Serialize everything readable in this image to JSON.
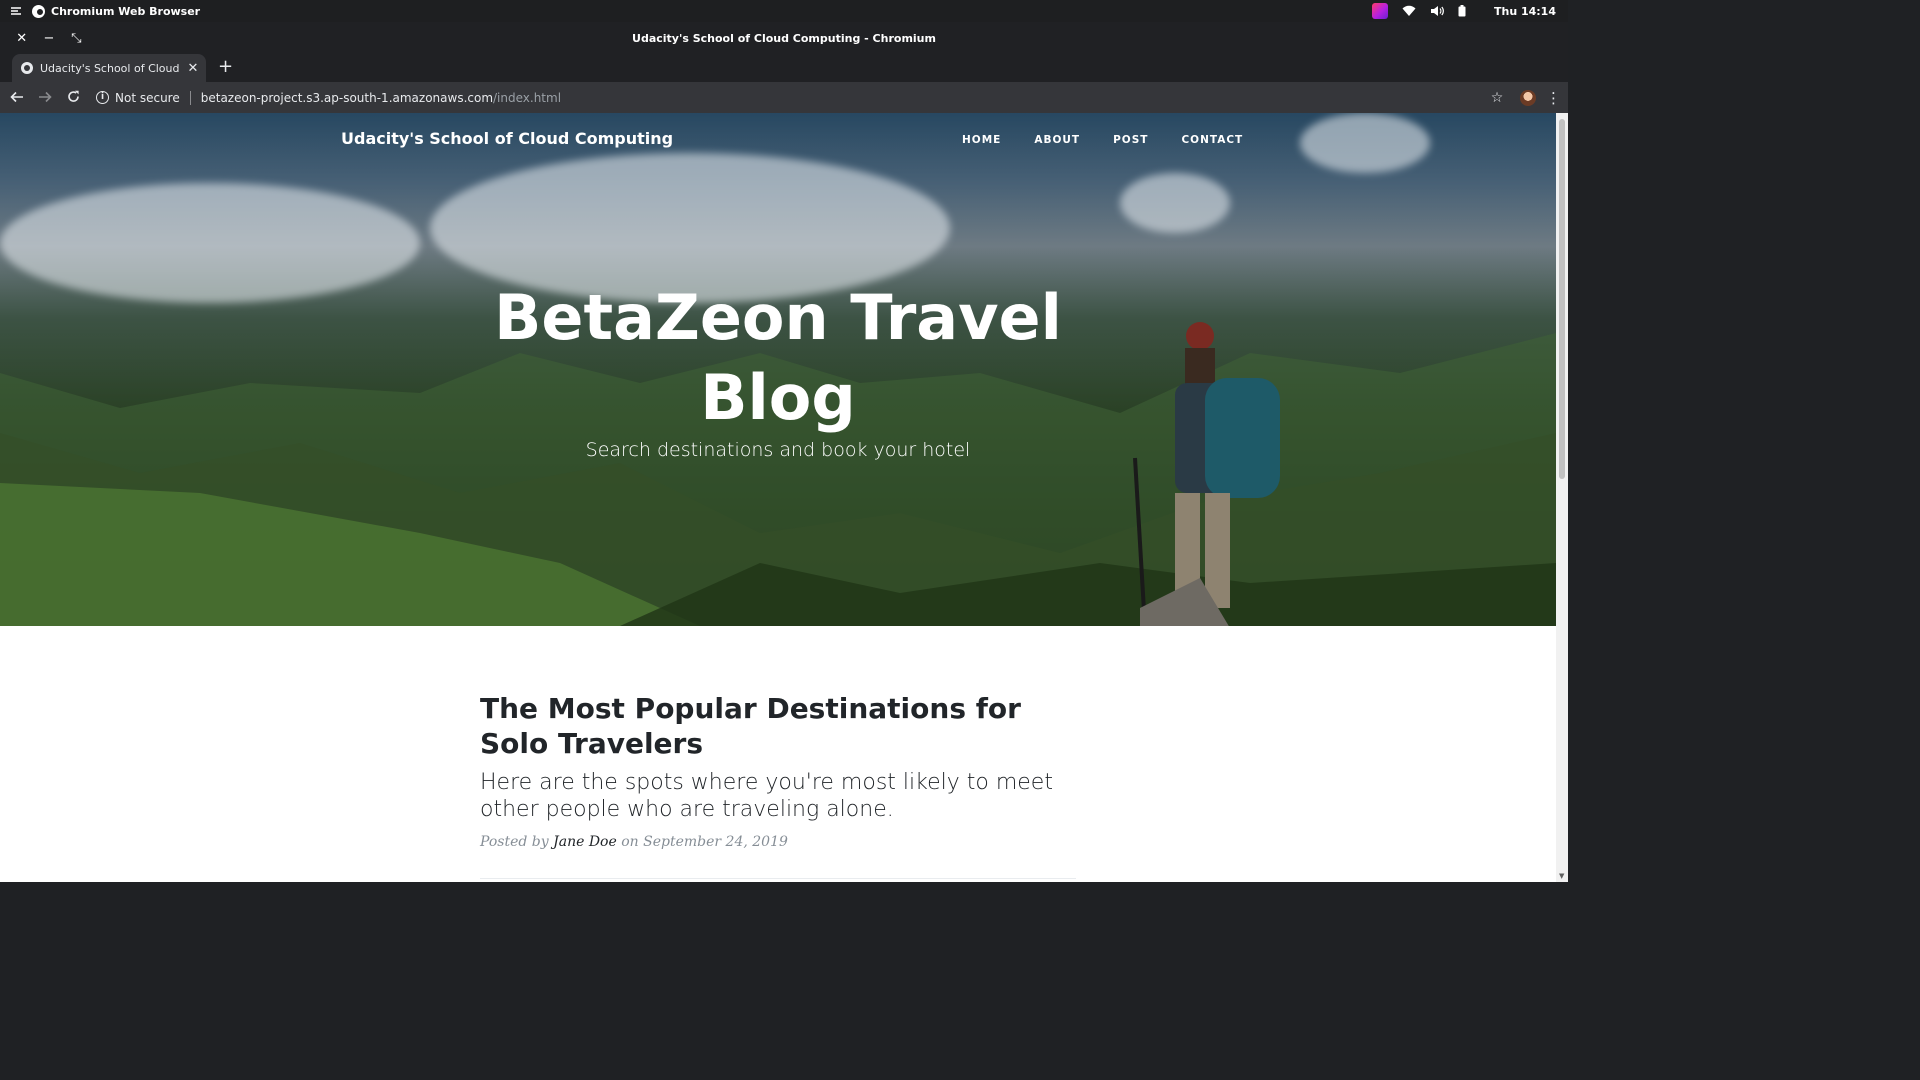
{
  "os": {
    "app_name": "Chromium Web Browser",
    "clock": "Thu 14:14"
  },
  "window": {
    "title": "Udacity's School of Cloud Computing - Chromium",
    "close_glyph": "✕",
    "minimize_glyph": "−",
    "maximize_glyph": "⤡"
  },
  "tabs": [
    {
      "title": "Udacity's School of Cloud C",
      "active": true
    }
  ],
  "new_tab_glyph": "+",
  "toolbar": {
    "security_label": "Not secure",
    "url_host": "betazeon-project.s3.ap-south-1.amazonaws.com",
    "url_path": "/index.html"
  },
  "site": {
    "brand": "Udacity's School of Cloud Computing",
    "nav": [
      "HOME",
      "ABOUT",
      "POST",
      "CONTACT"
    ],
    "hero_title_line1": "BetaZeon Travel",
    "hero_title_line2": "Blog",
    "hero_subtitle": "Search destinations and book your hotel"
  },
  "post": {
    "title": "The Most Popular Destinations for Solo Travelers",
    "subtitle": "Here are the spots where you're most likely to meet other people who are traveling alone.",
    "meta_prefix": "Posted by",
    "author": "Jane Doe",
    "meta_on": "on",
    "date": "September 24, 2019"
  },
  "colors": {
    "chrome_dark": "#202124",
    "chrome_toolbar": "#35363a",
    "text_dark": "#212529",
    "meta_gray": "#868e96"
  }
}
